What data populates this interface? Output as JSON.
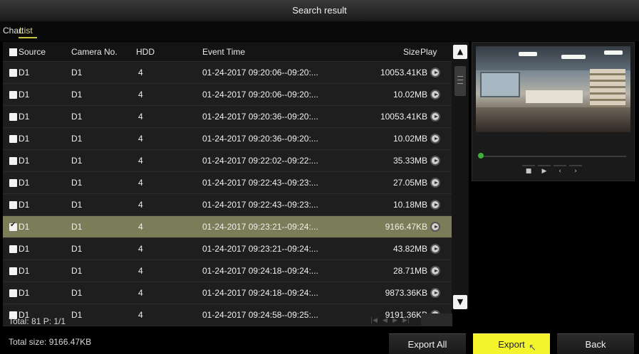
{
  "window": {
    "title": "Search result"
  },
  "tabs": [
    {
      "label": "Chart"
    },
    {
      "label": "List"
    }
  ],
  "table": {
    "headers": {
      "source": "Source",
      "camera": "Camera No.",
      "hdd": "HDD",
      "event_time": "Event Time",
      "size": "Size",
      "play": "Play"
    },
    "rows": [
      {
        "source": "D1",
        "camera": "D1",
        "hdd": "4",
        "event_time": "01-24-2017 09:20:06--09:20:...",
        "size": "10053.41KB",
        "checked": false
      },
      {
        "source": "D1",
        "camera": "D1",
        "hdd": "4",
        "event_time": "01-24-2017 09:20:06--09:20:...",
        "size": "10.02MB",
        "checked": false
      },
      {
        "source": "D1",
        "camera": "D1",
        "hdd": "4",
        "event_time": "01-24-2017 09:20:36--09:20:...",
        "size": "10053.41KB",
        "checked": false
      },
      {
        "source": "D1",
        "camera": "D1",
        "hdd": "4",
        "event_time": "01-24-2017 09:20:36--09:20:...",
        "size": "10.02MB",
        "checked": false
      },
      {
        "source": "D1",
        "camera": "D1",
        "hdd": "4",
        "event_time": "01-24-2017 09:22:02--09:22:...",
        "size": "35.33MB",
        "checked": false
      },
      {
        "source": "D1",
        "camera": "D1",
        "hdd": "4",
        "event_time": "01-24-2017 09:22:43--09:23:...",
        "size": "27.05MB",
        "checked": false
      },
      {
        "source": "D1",
        "camera": "D1",
        "hdd": "4",
        "event_time": "01-24-2017 09:22:43--09:23:...",
        "size": "10.18MB",
        "checked": false
      },
      {
        "source": "D1",
        "camera": "D1",
        "hdd": "4",
        "event_time": "01-24-2017 09:23:21--09:24:...",
        "size": "9166.47KB",
        "checked": true
      },
      {
        "source": "D1",
        "camera": "D1",
        "hdd": "4",
        "event_time": "01-24-2017 09:23:21--09:24:...",
        "size": "43.82MB",
        "checked": false
      },
      {
        "source": "D1",
        "camera": "D1",
        "hdd": "4",
        "event_time": "01-24-2017 09:24:18--09:24:...",
        "size": "28.71MB",
        "checked": false
      },
      {
        "source": "D1",
        "camera": "D1",
        "hdd": "4",
        "event_time": "01-24-2017 09:24:18--09:24:...",
        "size": "9873.36KB",
        "checked": false
      },
      {
        "source": "D1",
        "camera": "D1",
        "hdd": "4",
        "event_time": "01-24-2017 09:24:58--09:25:...",
        "size": "9191.36KB",
        "checked": false
      }
    ]
  },
  "footer": {
    "total": "Total: 81  P: 1/1",
    "total_size": "Total size: 9166.47KB"
  },
  "buttons": {
    "export_all": "Export All",
    "export": "Export",
    "back": "Back"
  },
  "colors": {
    "accent": "#f4f42c",
    "selected_row": "#7b7d58",
    "active_tab": "#c6c640"
  }
}
